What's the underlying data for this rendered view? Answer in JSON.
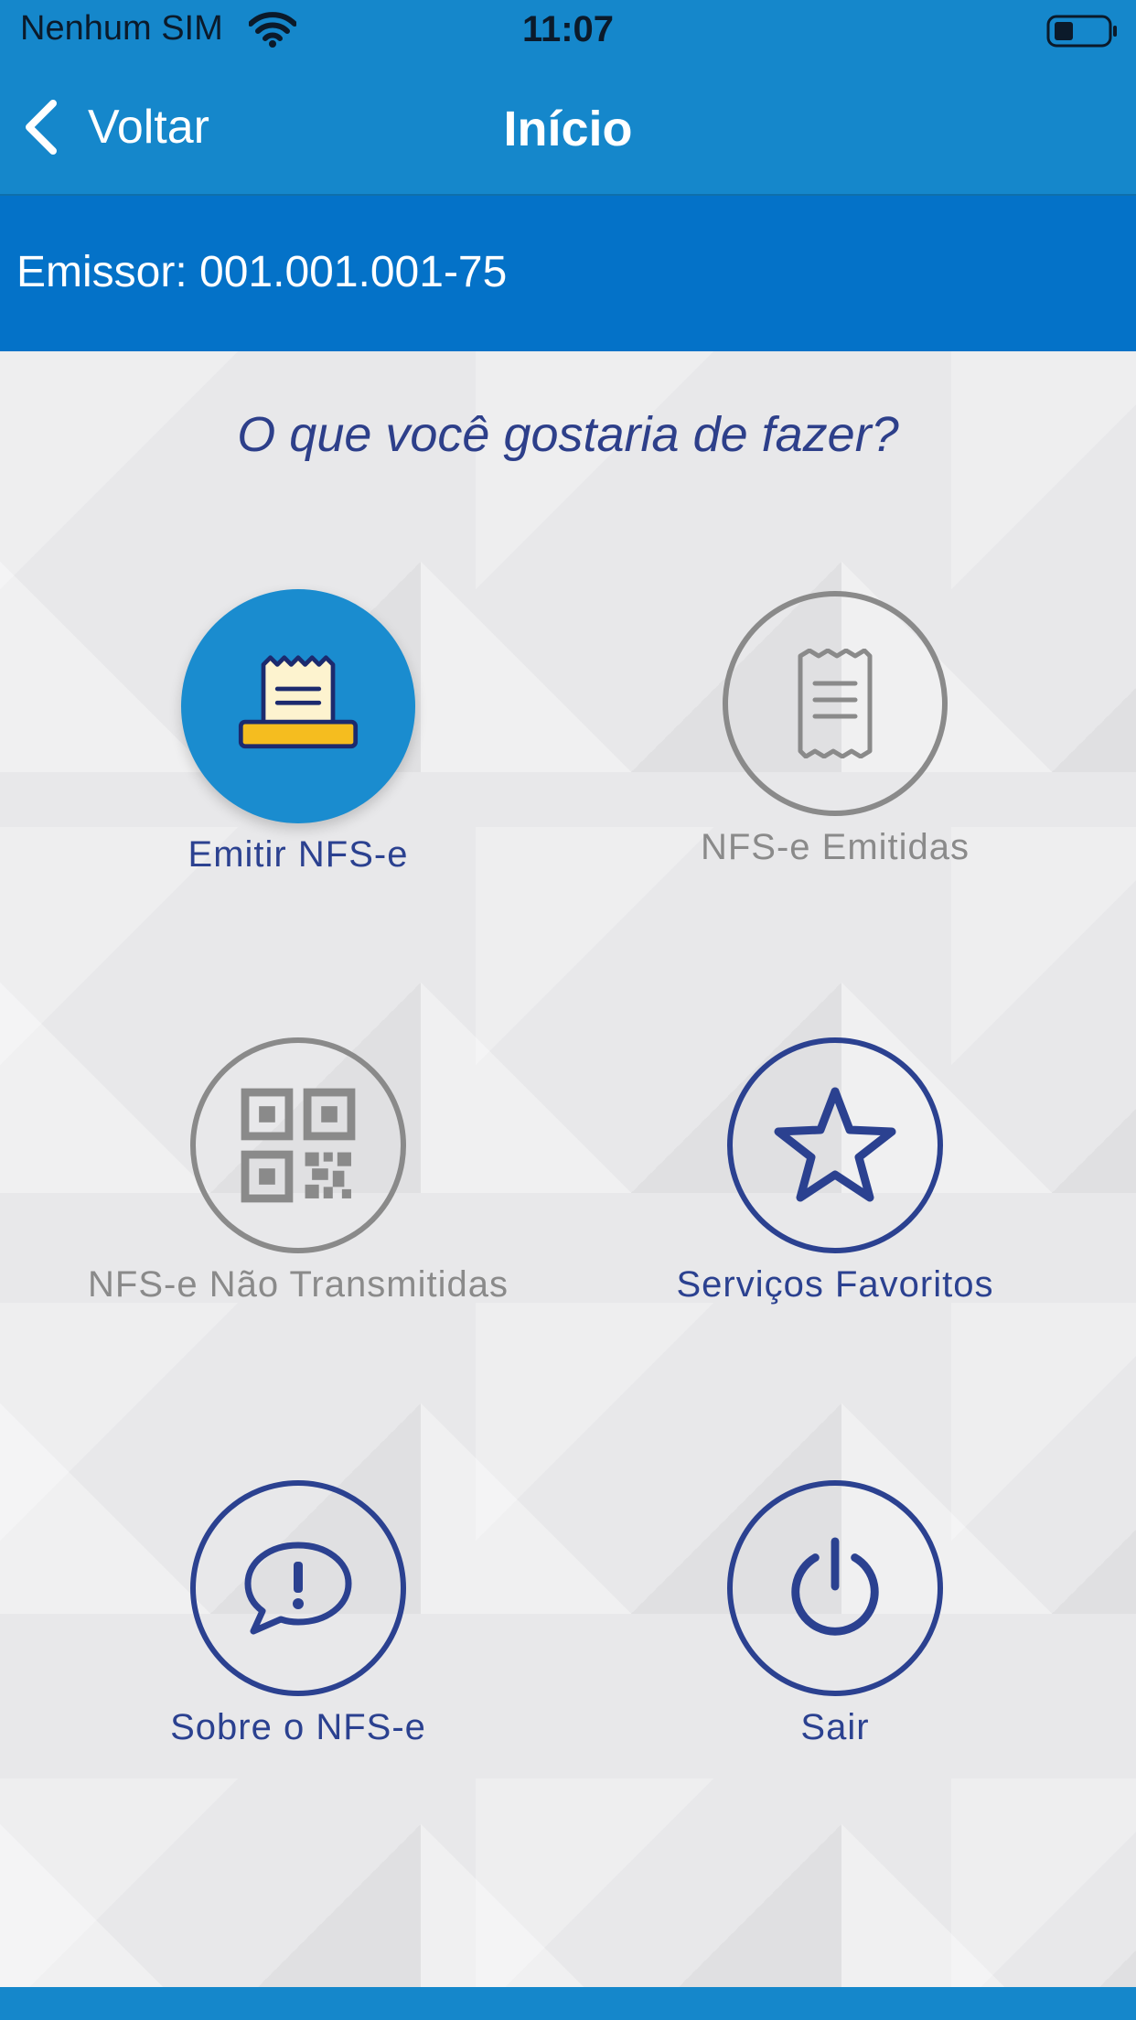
{
  "status_bar": {
    "carrier": "Nenhum SIM",
    "time": "11:07",
    "wifi_icon": "wifi-icon",
    "battery_icon": "battery-icon"
  },
  "nav": {
    "back_label": "Voltar",
    "title": "Início"
  },
  "issuer": {
    "text": "Emissor: 001.001.001-75"
  },
  "question": "O que você gostaria de fazer?",
  "menu": {
    "emitir": {
      "label": "Emitir NFS-e",
      "icon": "receipt-printer-icon"
    },
    "emitidas": {
      "label": "NFS-e Emitidas",
      "icon": "receipt-icon"
    },
    "nao_transmitidas": {
      "label": "NFS-e Não Transmitidas",
      "icon": "qr-code-icon"
    },
    "favoritos": {
      "label": "Serviços Favoritos",
      "icon": "star-icon"
    },
    "sobre": {
      "label": "Sobre o NFS-e",
      "icon": "speech-bubble-exclamation-icon"
    },
    "sair": {
      "label": "Sair",
      "icon": "power-icon"
    }
  },
  "colors": {
    "header_blue": "#1587cb",
    "issuer_blue": "#0472c8",
    "brand_navy": "#2b4190",
    "disabled_gray": "#8a8a8a",
    "highlight_yellow": "#f5bd1f"
  }
}
